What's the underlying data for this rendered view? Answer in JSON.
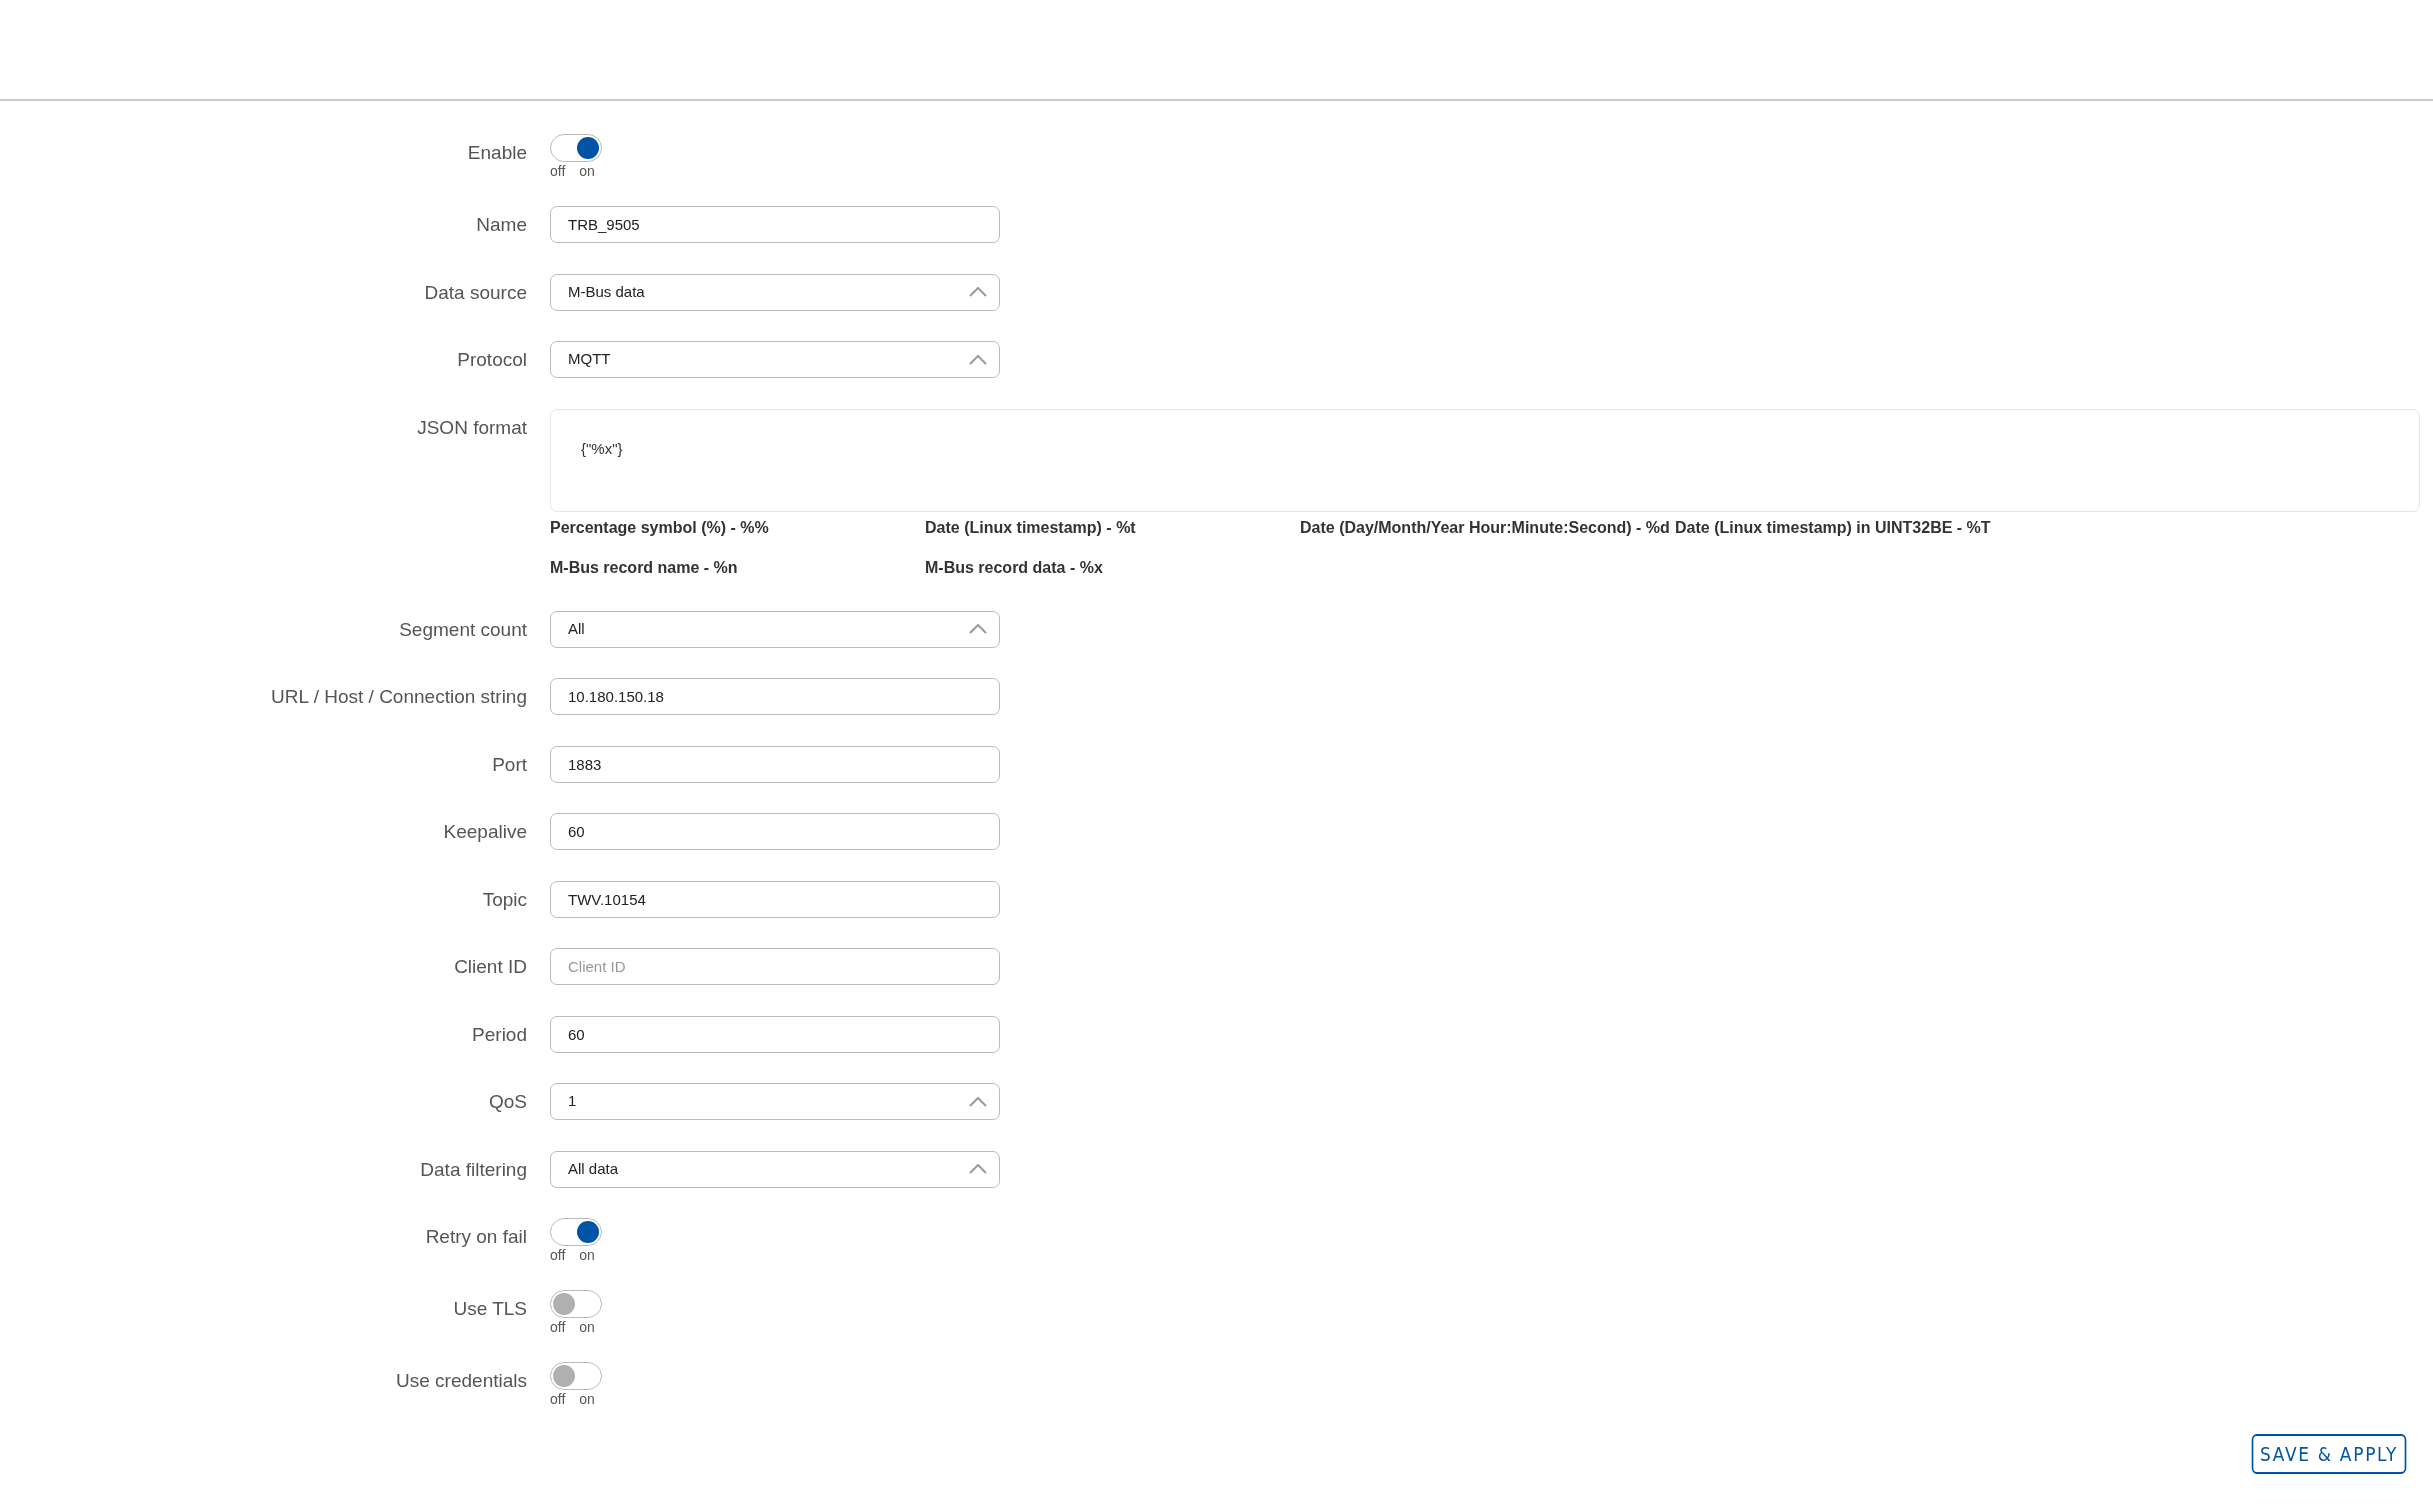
{
  "fields": [
    {
      "kind": "switch",
      "label": "Enable",
      "on": true,
      "off_text": "off",
      "on_text": "on"
    },
    {
      "kind": "text",
      "label": "Name",
      "value": "TRB_9505"
    },
    {
      "kind": "select",
      "label": "Data source",
      "value": "M-Bus data"
    },
    {
      "kind": "select",
      "label": "Protocol",
      "value": "MQTT"
    },
    {
      "kind": "textarea",
      "label": "JSON format",
      "value": "{\"%x\"}",
      "hints": [
        "Percentage symbol (%) - %%",
        "Date (Linux timestamp) - %t",
        "Date (Day/Month/Year Hour:Minute:Second) - %d",
        "Date (Linux timestamp) in UINT32BE - %T",
        "M-Bus record name - %n",
        "M-Bus record data - %x"
      ]
    },
    {
      "kind": "select",
      "label": "Segment count",
      "value": "All"
    },
    {
      "kind": "text",
      "label": "URL / Host / Connection string",
      "value": "10.180.150.18"
    },
    {
      "kind": "text",
      "label": "Port",
      "value": "1883"
    },
    {
      "kind": "text",
      "label": "Keepalive",
      "value": "60"
    },
    {
      "kind": "text",
      "label": "Topic",
      "value": "TWV.10154"
    },
    {
      "kind": "text",
      "label": "Client ID",
      "placeholder": "Client ID"
    },
    {
      "kind": "text",
      "label": "Period",
      "value": "60"
    },
    {
      "kind": "select",
      "label": "QoS",
      "value": "1"
    },
    {
      "kind": "select",
      "label": "Data filtering",
      "value": "All data"
    },
    {
      "kind": "switch",
      "label": "Retry on fail",
      "on": true,
      "off_text": "off",
      "on_text": "on"
    },
    {
      "kind": "switch",
      "label": "Use TLS",
      "on": false,
      "off_text": "off",
      "on_text": "on"
    },
    {
      "kind": "switch",
      "label": "Use credentials",
      "on": false,
      "off_text": "off",
      "on_text": "on"
    }
  ],
  "save_button": "SAVE & APPLY"
}
